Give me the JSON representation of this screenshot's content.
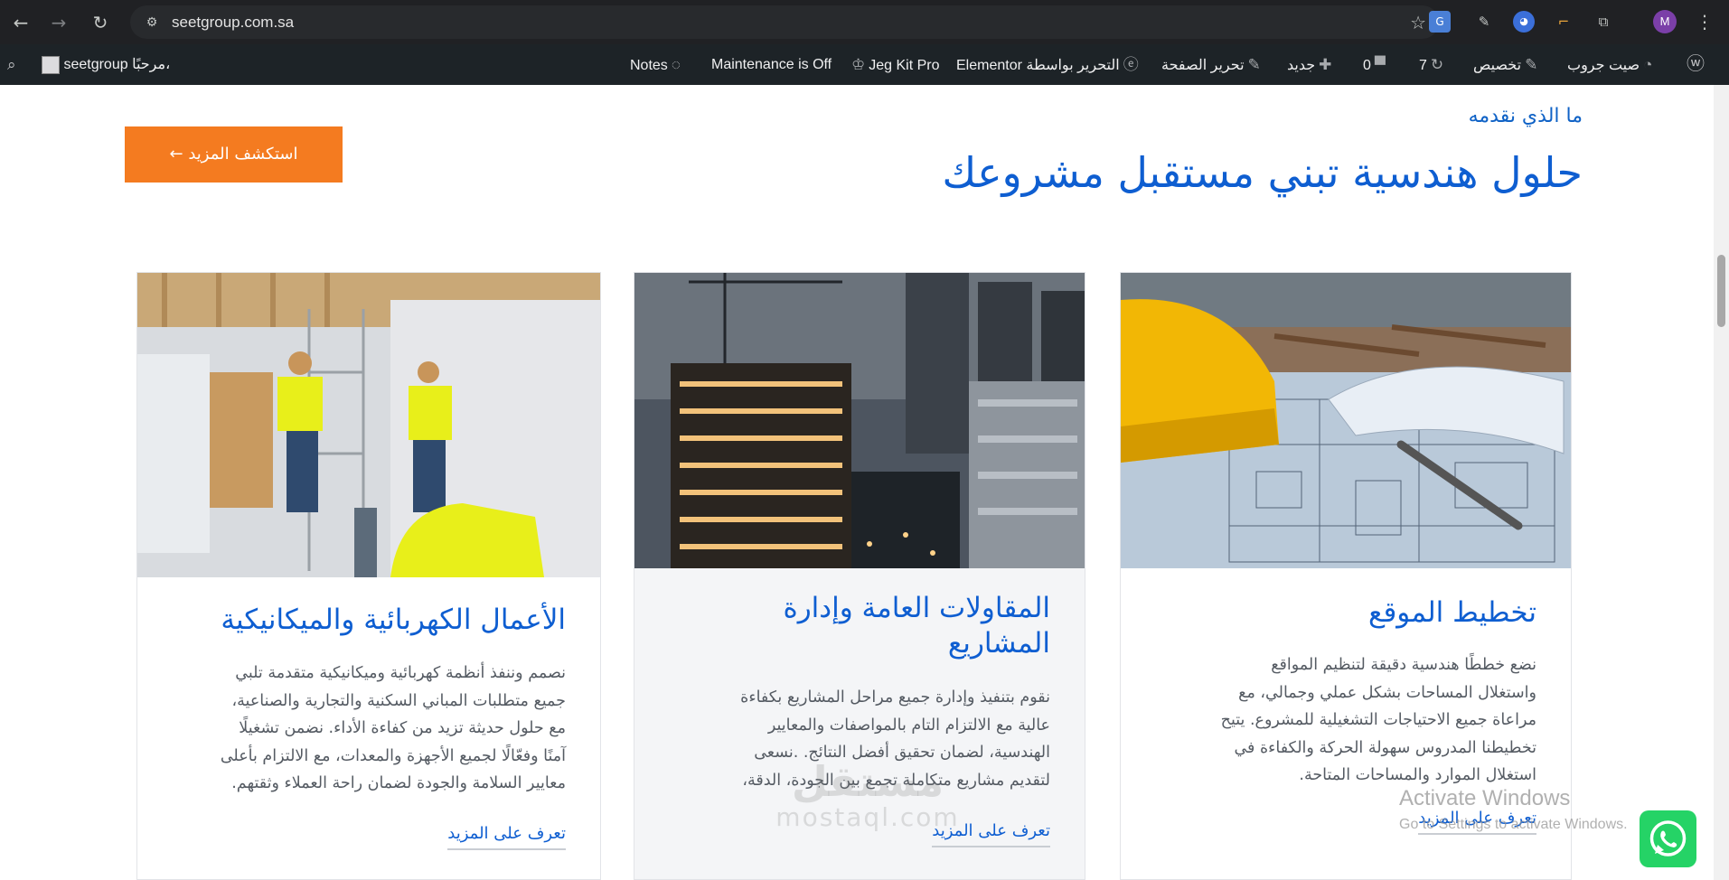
{
  "browser": {
    "url": "seetgroup.com.sa",
    "profile_initial": "M",
    "icons": [
      "back-icon",
      "forward-icon",
      "reload-icon",
      "site-info-icon",
      "bookmark-star-icon",
      "translate-icon",
      "eyedropper-icon",
      "extension-icon",
      "puzzle-icon",
      "menu-icon"
    ]
  },
  "adminbar": {
    "site_name": "صيت جروب",
    "customize": "تخصيص",
    "updates": "7",
    "comments": "0",
    "new": "جديد",
    "edit_page": "تحرير الصفحة",
    "elementor": "Elementor التحرير بواسطة",
    "jegkit": "Jeg Kit Pro",
    "maintenance": "Maintenance is Off",
    "notes": "Notes",
    "howdy": "مرحبًا،",
    "user": "seetgroup"
  },
  "section": {
    "eyebrow": "ما الذي نقدمه",
    "title": "حلول هندسية تبني مستقبل مشروعك",
    "cta": "استكشف المزيد ←"
  },
  "cards": [
    {
      "title": "تخطيط الموقع",
      "lines": [
        "نضع خططًا هندسية دقيقة لتنظيم المواقع",
        "واستغلال المساحات بشكل عملي وجمالي، مع",
        "مراعاة جميع الاحتياجات التشغيلية للمشروع. يتيح",
        "تخطيطنا المدروس سهولة الحركة والكفاءة في",
        "استغلال الموارد والمساحات المتاحة."
      ],
      "link": "تعرف على المزيد"
    },
    {
      "title_lines": [
        "المقاولات العامة وإدارة",
        "المشاريع"
      ],
      "lines": [
        "نقوم بتنفيذ وإدارة جميع مراحل المشاريع بكفاءة",
        "عالية مع الالتزام التام بالمواصفات والمعايير",
        "الهندسية، لضمان تحقيق أفضل النتائج. .نسعى",
        "لتقديم مشاريع متكاملة تجمع بين الجودة، الدقة،"
      ],
      "link": "تعرف على المزيد"
    },
    {
      "title": "الأعمال الكهربائية والميكانيكية",
      "lines": [
        "نصمم وننفذ أنظمة كهربائية وميكانيكية متقدمة تلبي",
        "جميع متطلبات المباني السكنية والتجارية والصناعية،",
        "مع حلول حديثة تزيد من كفاءة الأداء. نضمن تشغيلًا",
        "آمنًا وفعّالًا لجميع الأجهزة والمعدات، مع الالتزام بأعلى",
        "معايير السلامة والجودة لضمان راحة العملاء وثقتهم."
      ],
      "link": "تعرف على المزيد"
    }
  ],
  "overlays": {
    "watermark_ar": "مستقل",
    "watermark_en": "mostaql.com",
    "activate_title": "Activate Windows",
    "activate_sub": "Go to Settings to activate Windows."
  },
  "colors": {
    "accent_blue": "#0e5ed1",
    "cta_orange": "#f47b20",
    "whatsapp_green": "#25d366",
    "adminbar_bg": "#1d2327"
  }
}
